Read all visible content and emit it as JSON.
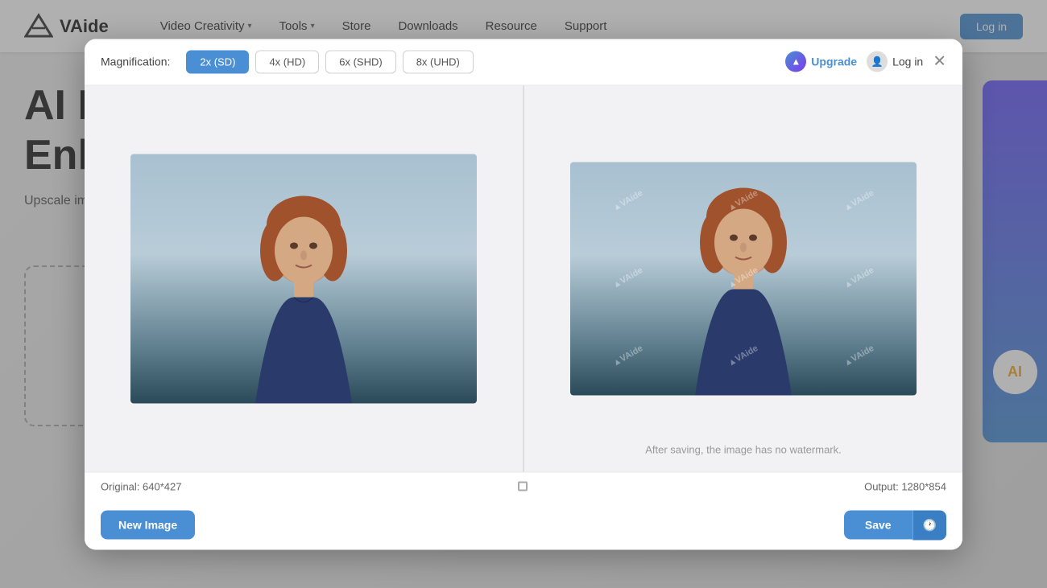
{
  "nav": {
    "logo_text": "VAide",
    "items": [
      {
        "label": "Video Creativity",
        "has_dropdown": true
      },
      {
        "label": "Tools",
        "has_dropdown": true
      },
      {
        "label": "Store",
        "has_dropdown": false
      },
      {
        "label": "Downloads",
        "has_dropdown": false
      },
      {
        "label": "Resource",
        "has_dropdown": false
      },
      {
        "label": "Support",
        "has_dropdown": false
      }
    ],
    "login_label": "Log in"
  },
  "hero": {
    "title_line1": "AI I",
    "title_line2": "Enla",
    "sub_text": "Upscale images without losing quality, fix blurry"
  },
  "modal": {
    "mag_label": "Magnification:",
    "mag_options": [
      {
        "label": "2x (SD)",
        "active": true
      },
      {
        "label": "4x (HD)",
        "active": false
      },
      {
        "label": "6x (SHD)",
        "active": false
      },
      {
        "label": "8x (UHD)",
        "active": false
      }
    ],
    "upgrade_label": "Upgrade",
    "login_label": "Log in",
    "close_title": "Close",
    "original_label": "Original: 640*427",
    "output_label": "Output: 1280*854",
    "watermark_text": "AVAide",
    "watermark_notice": "After saving, the image has no watermark.",
    "new_image_label": "New Image",
    "save_label": "Save",
    "colors": {
      "accent": "#4a8fd4"
    }
  }
}
